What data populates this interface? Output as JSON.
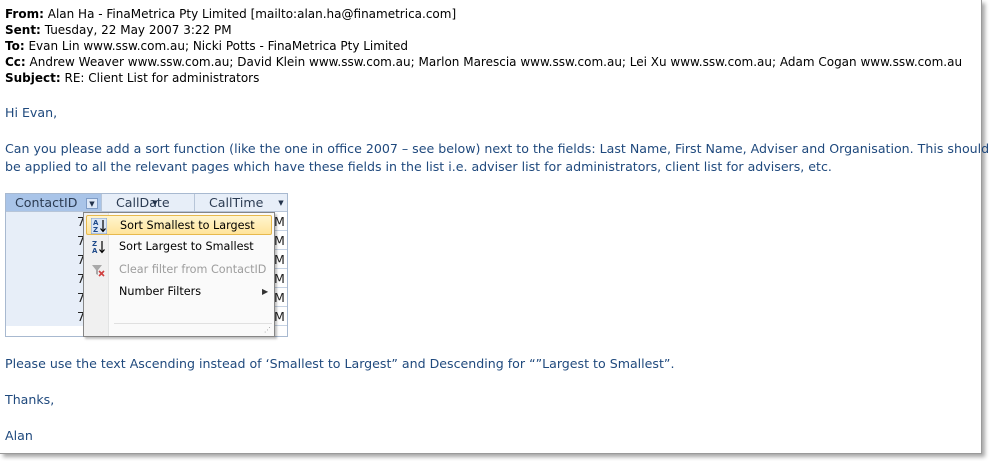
{
  "headers": {
    "from_label": "From:",
    "from_value": "Alan Ha - FinaMetrica Pty Limited [mailto:alan.ha@finametrica.com]",
    "sent_label": "Sent:",
    "sent_value": "Tuesday, 22 May 2007 3:22 PM",
    "to_label": "To:",
    "to_value": "Evan Lin www.ssw.com.au; Nicki Potts - FinaMetrica Pty Limited",
    "cc_label": "Cc:",
    "cc_value": "Andrew Weaver www.ssw.com.au; David Klein www.ssw.com.au; Marlon Marescia www.ssw.com.au; Lei Xu www.ssw.com.au; Adam Cogan www.ssw.com.au",
    "subject_label": "Subject:",
    "subject_value": "RE: Client List for administrators"
  },
  "body": {
    "greeting": "Hi Evan,",
    "para1_line1": "Can you please add a sort function (like the one in office 2007 – see below) next to the fields: Last Name, First Name, Adviser and Organisation. This should",
    "para1_line2": "be applied to all the relevant pages which have these fields in the list i.e. adviser list for administrators, client list for advisers, etc.",
    "para2": "Please use the text Ascending instead of ‘Smallest to Largest” and Descending for “”Largest to Smallest”.",
    "thanks": "Thanks,",
    "signature": "Alan"
  },
  "grid": {
    "columns": [
      "ContactID",
      "CallDate",
      "CallTime"
    ],
    "dropdown_glyph": "▼",
    "rows": [
      {
        "id": "7",
        "time_frag": "M"
      },
      {
        "id": "7",
        "time_frag": "M"
      },
      {
        "id": "7",
        "time_frag": "M"
      },
      {
        "id": "7",
        "time_frag": "M"
      },
      {
        "id": "7",
        "time_frag": "M"
      },
      {
        "id": "7",
        "time_frag": "M"
      }
    ]
  },
  "menu": {
    "items": [
      {
        "label": "Sort Smallest to Largest",
        "icon": "sort-ascending-icon",
        "highlighted": true
      },
      {
        "label": "Sort Largest to Smallest",
        "icon": "sort-descending-icon"
      },
      {
        "label": "Clear filter from ContactID",
        "icon": "clear-filter-icon",
        "disabled": true
      },
      {
        "label": "Number Filters",
        "submenu_glyph": "▶"
      }
    ],
    "icon_letter_a": "A",
    "icon_letter_z": "Z",
    "grip_glyph": "⋰"
  },
  "colors": {
    "body_text": "#1f497d",
    "header_text": "#000000",
    "grid_header_selected": "#a9c4e8",
    "menu_highlight": "#ffe49b"
  }
}
